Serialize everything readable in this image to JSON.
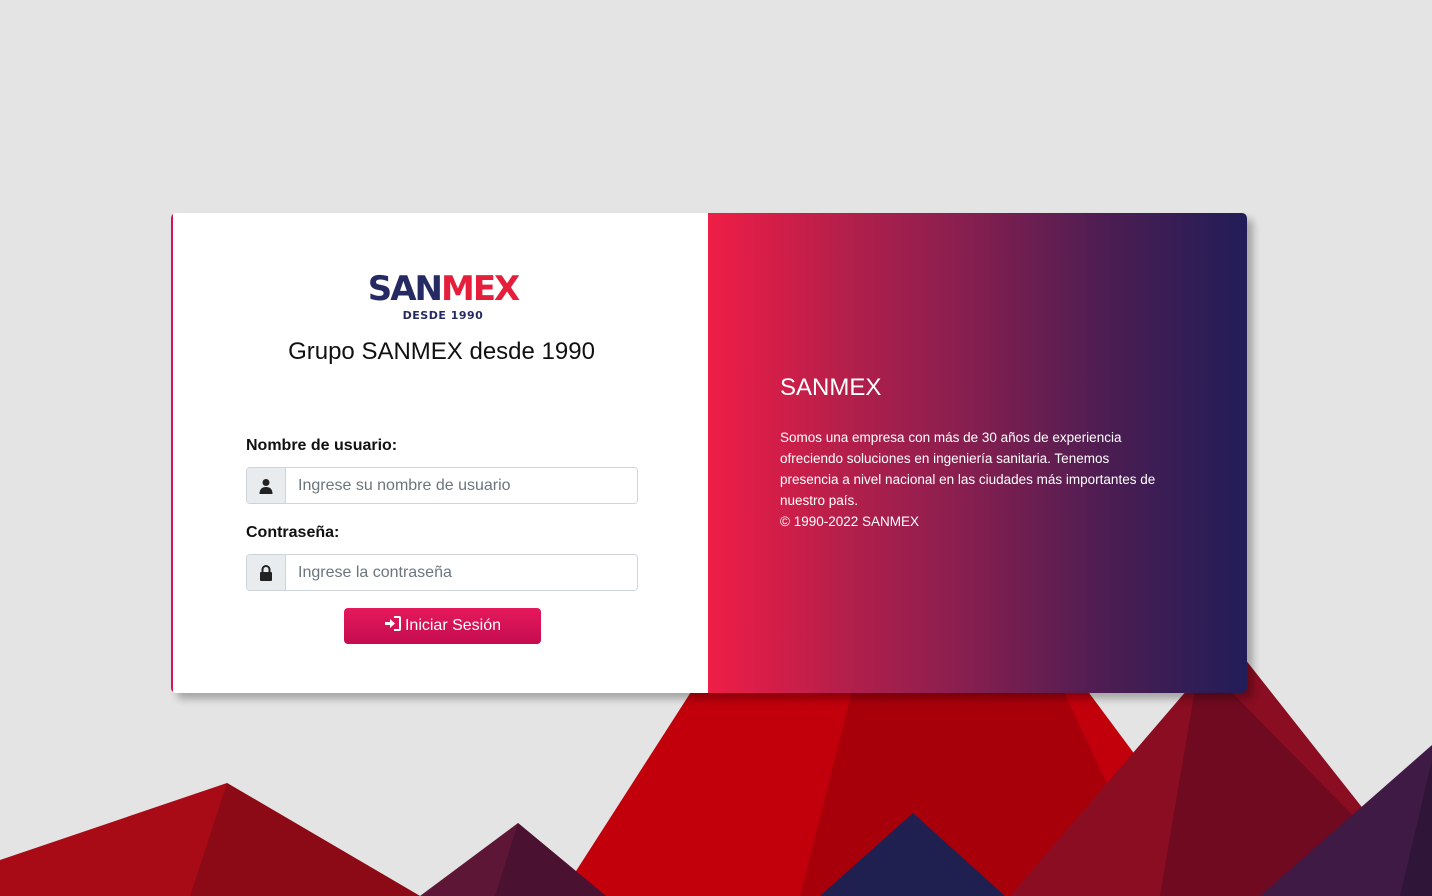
{
  "brand": {
    "logo_primary": "SAN",
    "logo_accent": "MEX",
    "logo_tagline": "DESDE 1990",
    "title": "Grupo SANMEX desde 1990"
  },
  "login_form": {
    "username_label": "Nombre de usuario:",
    "username_placeholder": "Ingrese su nombre de usuario",
    "username_value": "",
    "username_icon": "user-icon",
    "password_label": "Contraseña:",
    "password_placeholder": "Ingrese la contraseña",
    "password_value": "",
    "password_icon": "lock-icon",
    "submit_label": "Iniciar Sesión",
    "submit_icon": "sign-in-icon"
  },
  "info_panel": {
    "title": "SANMEX",
    "description": "Somos una empresa con más de 30 años de experiencia ofreciendo soluciones en ingeniería sanitaria. Tenemos presencia a nivel nacional en las ciudades más importantes de nuestro país.",
    "copyright": "© 1990-2022 SANMEX"
  },
  "colors": {
    "page_background": "#e4e4e4",
    "brand_navy": "#262a63",
    "brand_red": "#e51f3b",
    "button_magenta": "#d4145a",
    "panel_gradient_start": "#ef1e46",
    "panel_gradient_end": "#211d58"
  }
}
